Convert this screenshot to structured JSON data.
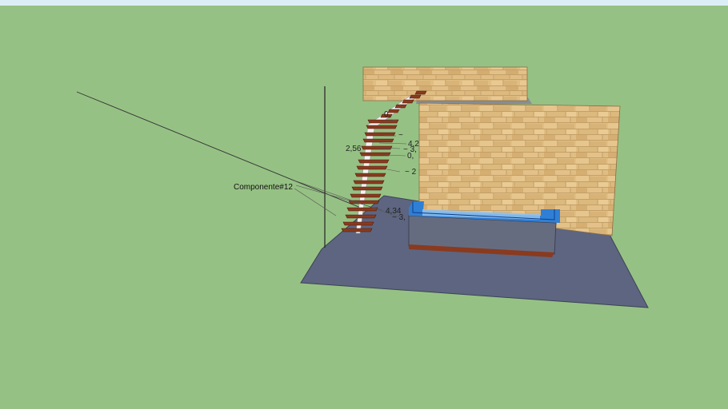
{
  "scene": {
    "colors": {
      "sky": "#dbeef7",
      "ground": "#96c184",
      "floor": "#5d6580",
      "stone": "#e0bd82",
      "stone_line": "#b89660",
      "water": "#2f7fd6",
      "pool_body": "#666c80",
      "wood": "#8a3a1e",
      "stringer": "#f4f4f4",
      "slab_top": "#888d94"
    },
    "component_label": "Componente#12",
    "dimensions": [
      {
        "text": "0,"
      },
      {
        "text": "~"
      },
      {
        "text": "4,2"
      },
      {
        "text": "2,56"
      },
      {
        "text": "~ 3,"
      },
      {
        "text": "0,"
      },
      {
        "text": "~ 2"
      },
      {
        "text": "4,34"
      },
      {
        "text": "~ 3,"
      }
    ]
  }
}
